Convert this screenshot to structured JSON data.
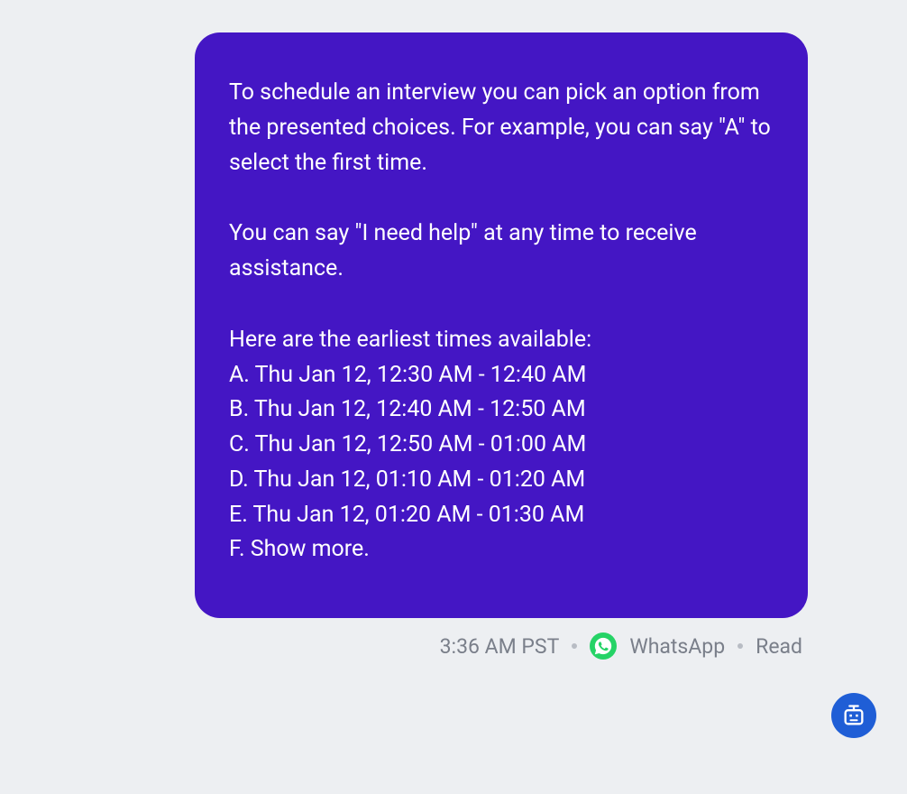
{
  "message": {
    "intro_line1": "To schedule an interview you can pick an option from the presented choices. For example, you can say \"A\" to select the first time.",
    "help_line": "You can say \"I need help\" at any time to receive assistance.",
    "times_heading": "Here are the earliest times available:",
    "options": {
      "a": "A. Thu Jan 12, 12:30 AM - 12:40 AM",
      "b": "B. Thu Jan 12, 12:40 AM - 12:50 AM",
      "c": "C. Thu Jan 12, 12:50 AM - 01:00 AM",
      "d": "D. Thu Jan 12, 01:10 AM - 01:20 AM",
      "e": "E. Thu Jan 12, 01:20 AM - 01:30 AM",
      "f": "F. Show more."
    }
  },
  "meta": {
    "timestamp": "3:36 AM PST",
    "channel": "WhatsApp",
    "status": "Read"
  },
  "colors": {
    "bubble": "#4416c4",
    "page_bg": "#edeff2",
    "meta_text": "#7a7f8a",
    "whatsapp_green": "#25D366",
    "bot_badge": "#1f5ed6"
  }
}
